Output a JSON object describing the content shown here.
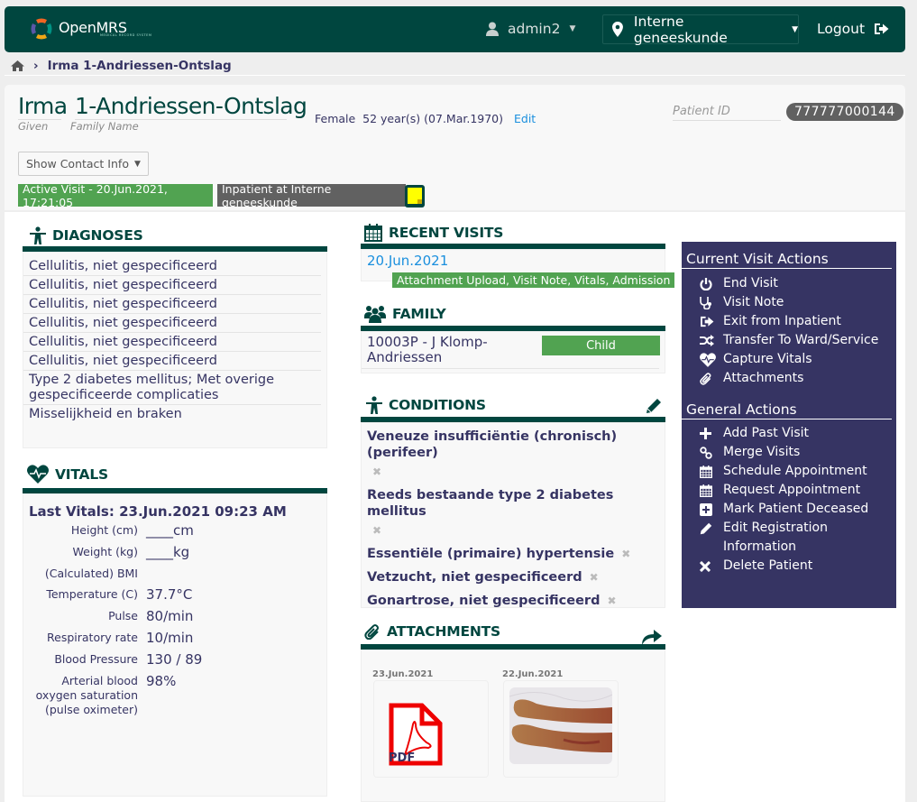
{
  "header": {
    "logo_text": "OpenMRS",
    "logo_subtitle": "MEDICAL RECORD SYSTEM",
    "user": "admin2",
    "location": "Interne geneeskunde",
    "logout": "Logout"
  },
  "breadcrumb": {
    "home_icon": "home-icon",
    "current": "Irma 1-Andriessen-Ontslag"
  },
  "patient": {
    "given": "Irma",
    "family": "1-Andriessen-Ontslag",
    "given_label": "Given",
    "family_label": "Family Name",
    "gender": "Female",
    "age": "52 year(s) (07.Mar.1970)",
    "edit": "Edit",
    "id_label": "Patient ID",
    "id_value": "777777000144",
    "contact_button": "Show Contact Info",
    "active_visit": "Active Visit - 20.Jun.2021, 17:21:05",
    "inpatient": "Inpatient at Interne geneeskunde"
  },
  "diagnoses": {
    "title": "DIAGNOSES",
    "items": [
      "Cellulitis, niet gespecificeerd",
      "Cellulitis, niet gespecificeerd",
      "Cellulitis, niet gespecificeerd",
      "Cellulitis, niet gespecificeerd",
      "Cellulitis, niet gespecificeerd",
      "Cellulitis, niet gespecificeerd",
      "Type 2 diabetes mellitus; Met overige gespecificeerde complicaties",
      "Misselijkheid en braken"
    ]
  },
  "vitals": {
    "title": "VITALS",
    "last": "Last Vitals: 23.Jun.2021 09:23 AM",
    "rows": [
      {
        "label": "Height (cm)",
        "value": "____cm"
      },
      {
        "label": "Weight (kg)",
        "value": "____kg"
      },
      {
        "label": "(Calculated) BMI",
        "value": ""
      },
      {
        "label": "Temperature (C)",
        "value": "37.7°C"
      },
      {
        "label": "Pulse",
        "value": "80/min"
      },
      {
        "label": "Respiratory rate",
        "value": "10/min"
      },
      {
        "label": "Blood Pressure",
        "value": "130 / 89"
      },
      {
        "label": "Arterial blood oxygen saturation (pulse oximeter)",
        "value": "98%"
      }
    ]
  },
  "recent_visits": {
    "title": "RECENT VISITS",
    "items": [
      {
        "date": "20.Jun.2021",
        "types": "Attachment Upload, Visit Note, Vitals, Admission"
      }
    ]
  },
  "family": {
    "title": "FAMILY",
    "items": [
      {
        "name": "10003P - J Klomp-Andriessen",
        "relation": "Child"
      }
    ]
  },
  "conditions": {
    "title": "CONDITIONS",
    "items": [
      "Veneuze insufficiëntie (chronisch) (perifeer)",
      "Reeds bestaande type 2 diabetes mellitus",
      "Essentiële (primaire) hypertensie",
      "Vetzucht, niet gespecificeerd",
      "Gonartrose, niet gespecificeerd"
    ]
  },
  "attachments": {
    "title": "ATTACHMENTS",
    "items": [
      {
        "date": "23.Jun.2021",
        "type": "pdf",
        "label": "PDF"
      },
      {
        "date": "22.Jun.2021",
        "type": "image"
      }
    ]
  },
  "current_visit_actions": {
    "title": "Current Visit Actions",
    "items": [
      {
        "label": "End Visit",
        "icon": "power-icon"
      },
      {
        "label": "Visit Note",
        "icon": "stethoscope-icon"
      },
      {
        "label": "Exit from Inpatient",
        "icon": "sign-out-icon"
      },
      {
        "label": "Transfer To Ward/Service",
        "icon": "shuffle-icon"
      },
      {
        "label": "Capture Vitals",
        "icon": "heartbeat-icon"
      },
      {
        "label": "Attachments",
        "icon": "paperclip-icon"
      }
    ]
  },
  "general_actions": {
    "title": "General Actions",
    "items": [
      {
        "label": "Add Past Visit",
        "icon": "plus-icon"
      },
      {
        "label": "Merge Visits",
        "icon": "link-icon"
      },
      {
        "label": "Schedule Appointment",
        "icon": "calendar-icon"
      },
      {
        "label": "Request Appointment",
        "icon": "calendar-icon"
      },
      {
        "label": "Mark Patient Deceased",
        "icon": "plus-square-icon"
      },
      {
        "label": "Edit Registration Information",
        "icon": "pencil-icon"
      },
      {
        "label": "Delete Patient",
        "icon": "x-icon"
      }
    ]
  },
  "colors": {
    "brand": "#00463f",
    "action_panel": "#363463",
    "success": "#51a351",
    "badge_gray": "#616161",
    "link": "#1a8fde"
  }
}
